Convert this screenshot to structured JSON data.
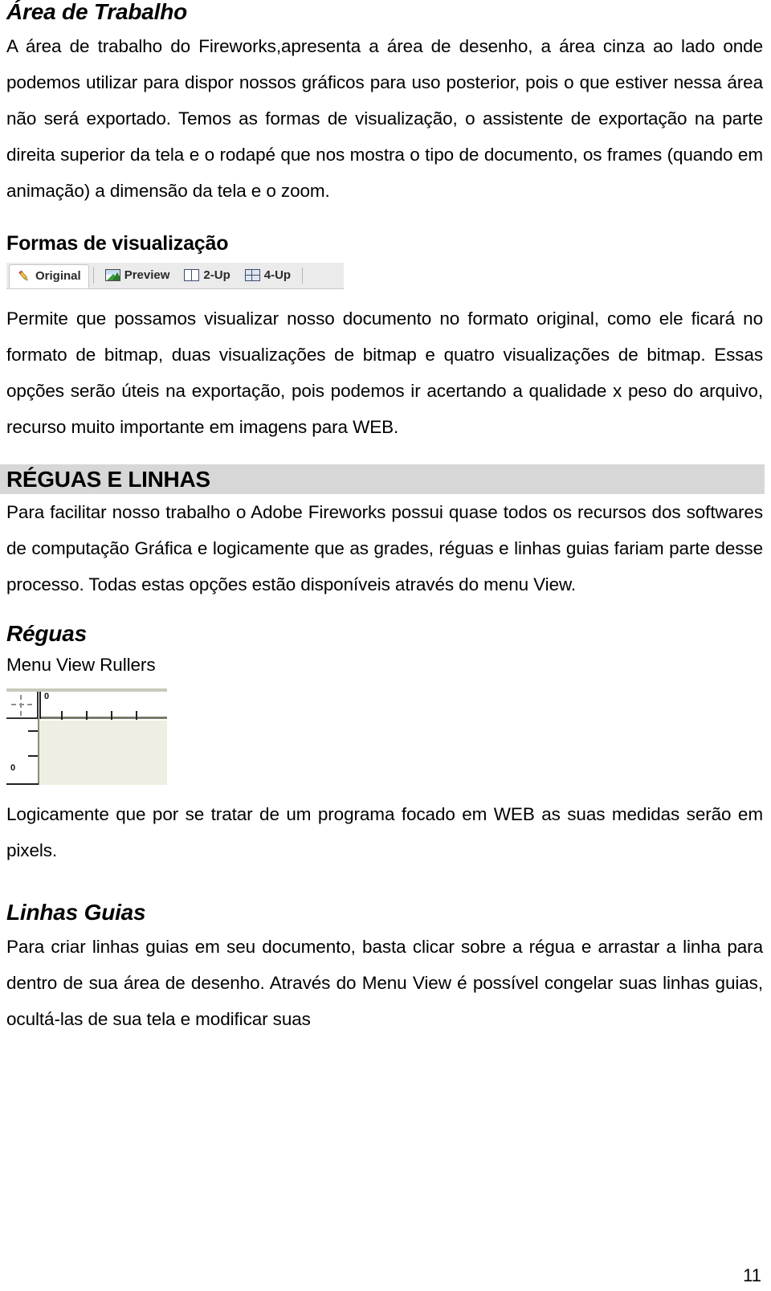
{
  "document": {
    "page_number": "11",
    "colors": {
      "band_background": "#d7d7d7",
      "toolbar_background": "#ebebeb",
      "canvas_fill": "#eeeee2",
      "text": "#000000"
    }
  },
  "sections": {
    "area_de_trabalho": {
      "heading": "Área de Trabalho",
      "paragraph": "A área de trabalho do Fireworks,apresenta a área de desenho, a área cinza ao lado onde podemos utilizar para dispor nossos gráficos para uso posterior, pois o que estiver nessa área não será exportado. Temos as formas de visualização, o assistente de exportação na parte direita superior da tela e o rodapé que nos mostra o tipo de documento, os frames (quando em animação) a dimensão da tela e o zoom."
    },
    "formas_de_visualizacao": {
      "heading": "Formas de visualização",
      "paragraph": "Permite que possamos visualizar nosso documento no formato original, como ele ficará no formato de bitmap, duas visualizações de bitmap e quatro visualizações de bitmap. Essas opções serão úteis na exportação, pois podemos ir acertando a qualidade x peso do arquivo, recurso muito importante em imagens para WEB."
    },
    "reguas_e_linhas": {
      "heading": "RÉGUAS E LINHAS",
      "paragraph": "Para facilitar nosso trabalho o Adobe Fireworks possui quase todos os recursos dos softwares de computação Gráfica e logicamente que as grades, réguas e linhas guias fariam parte desse processo. Todas estas opções estão disponíveis através do menu View."
    },
    "reguas": {
      "heading": "Réguas",
      "menu_path": "Menu View Rullers",
      "paragraph": "Logicamente que por se tratar de um programa focado em WEB as suas medidas serão em pixels."
    },
    "linhas_guias": {
      "heading": "Linhas Guias",
      "paragraph": "Para criar linhas guias em seu documento, basta clicar sobre a régua e arrastar a linha para dentro de sua área de desenho. Através do Menu View é possível congelar suas linhas guias, ocultá-las de sua tela e modificar suas"
    }
  },
  "figures": {
    "view_toolbar": {
      "tabs": [
        {
          "label": "Original",
          "icon": "pencil-icon",
          "active": true
        },
        {
          "label": "Preview",
          "icon": "image-preview-icon",
          "active": false
        },
        {
          "label": "2-Up",
          "icon": "two-pane-icon",
          "active": false
        },
        {
          "label": "4-Up",
          "icon": "four-pane-grid-icon",
          "active": false
        }
      ]
    },
    "ruler_screenshot": {
      "horizontal_zero_label": "0",
      "vertical_zero_label": "0"
    }
  }
}
